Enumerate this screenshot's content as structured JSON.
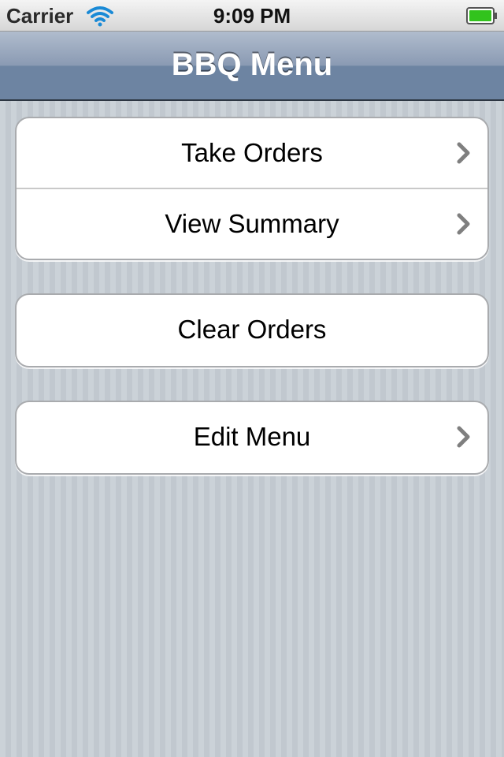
{
  "status_bar": {
    "carrier": "Carrier",
    "time": "9:09 PM",
    "icons": [
      "wifi-icon",
      "battery-icon"
    ],
    "battery_color": "#32c31d"
  },
  "nav_bar": {
    "title": "BBQ Menu"
  },
  "groups": [
    {
      "items": [
        {
          "label": "Take Orders",
          "accessory": "chevron-right-icon"
        },
        {
          "label": "View Summary",
          "accessory": "chevron-right-icon"
        }
      ]
    },
    {
      "items": [
        {
          "label": "Clear Orders",
          "accessory": ""
        }
      ]
    },
    {
      "items": [
        {
          "label": "Edit Menu",
          "accessory": "chevron-right-icon"
        }
      ]
    }
  ],
  "colors": {
    "nav_gradient_top": "#b0bccd",
    "nav_gradient_bottom": "#6d84a2",
    "background": "#c5ccd4",
    "chevron": "#7f7f7f"
  }
}
